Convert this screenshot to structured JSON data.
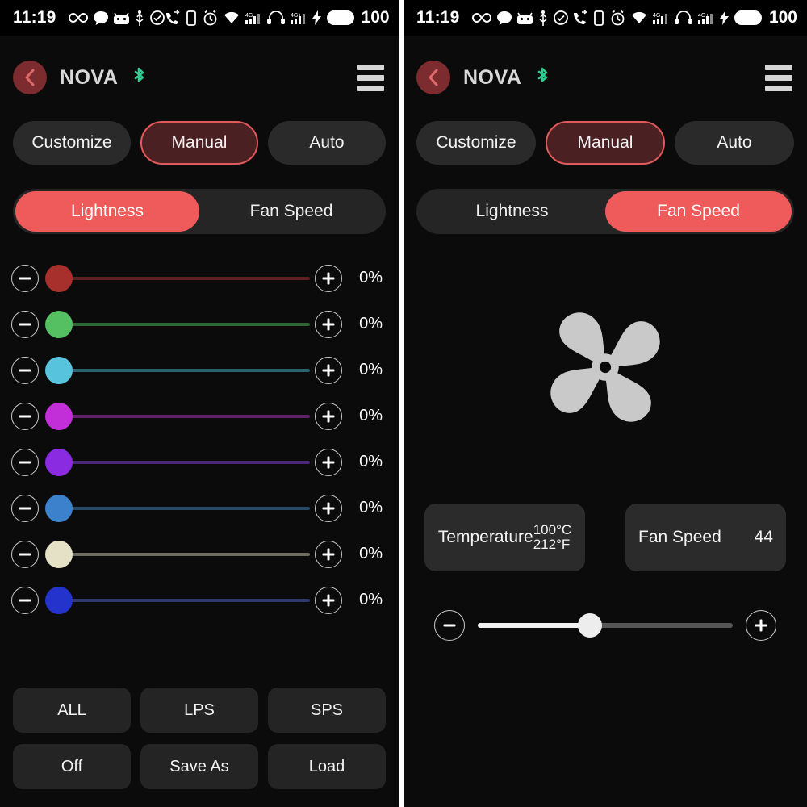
{
  "statusbar": {
    "time": "11:19",
    "battery_level": "100",
    "left_icons": [
      "infinity-icon",
      "chat-bubble-icon",
      "android-head-icon",
      "usb-icon",
      "check-circle-icon"
    ],
    "right_icons": [
      "call-forward-icon",
      "vibrate-icon",
      "alarm-icon",
      "wifi-icon",
      "signal-4g-icon",
      "hd-audio-icon",
      "signal-4gplus-icon",
      "charging-bolt-icon",
      "battery-icon"
    ]
  },
  "header": {
    "back_label": "‹",
    "title": "NOVA",
    "bluetooth_icon": "bluetooth-icon",
    "bluetooth_color": "#2ecc8f",
    "menu_icon": "hamburger-menu-icon"
  },
  "modes": [
    {
      "label": "Customize",
      "active": false
    },
    {
      "label": "Manual",
      "active": true
    },
    {
      "label": "Auto",
      "active": false
    }
  ],
  "left_panel": {
    "segments": [
      {
        "label": "Lightness",
        "active": true
      },
      {
        "label": "Fan Speed",
        "active": false
      }
    ],
    "decrease_label": "minus-icon",
    "increase_label": "plus-icon",
    "sliders": [
      {
        "color": "#a8302c",
        "track": "#5c2120",
        "value": "0%"
      },
      {
        "color": "#54c062",
        "track": "#2f6634",
        "value": "0%"
      },
      {
        "color": "#58c3dd",
        "track": "#2e6170",
        "value": "0%"
      },
      {
        "color": "#c22ed8",
        "track": "#5f2269",
        "value": "0%"
      },
      {
        "color": "#8a2be2",
        "track": "#4a2579",
        "value": "0%"
      },
      {
        "color": "#3b81cc",
        "track": "#274a69",
        "value": "0%"
      },
      {
        "color": "#e4e1c6",
        "track": "#6d6a5f",
        "value": "0%"
      },
      {
        "color": "#2433cc",
        "track": "#30386d",
        "value": "0%"
      }
    ],
    "buttons_row1": [
      {
        "label": "ALL"
      },
      {
        "label": "LPS"
      },
      {
        "label": "SPS"
      }
    ],
    "buttons_row2": [
      {
        "label": "Off"
      },
      {
        "label": "Save As"
      },
      {
        "label": "Load"
      }
    ]
  },
  "right_panel": {
    "segments": [
      {
        "label": "Lightness",
        "active": false
      },
      {
        "label": "Fan Speed",
        "active": true
      }
    ],
    "fan_icon": "fan-blade-icon",
    "fan_icon_color": "#c9c9c9",
    "temperature_card": {
      "label": "Temperature",
      "celsius": "100°C",
      "fahrenheit": "212°F"
    },
    "fan_speed_card": {
      "label": "Fan Speed",
      "value": "44"
    },
    "fan_slider": {
      "decrease_label": "minus-icon",
      "increase_label": "plus-icon",
      "percent": 44
    }
  },
  "theme": {
    "accent_red": "#ef5a5a",
    "accent_dark_red": "#4b2023",
    "panel_bg": "#0b0b0b",
    "card_bg": "#2b2b2b",
    "button_bg": "#242424"
  }
}
